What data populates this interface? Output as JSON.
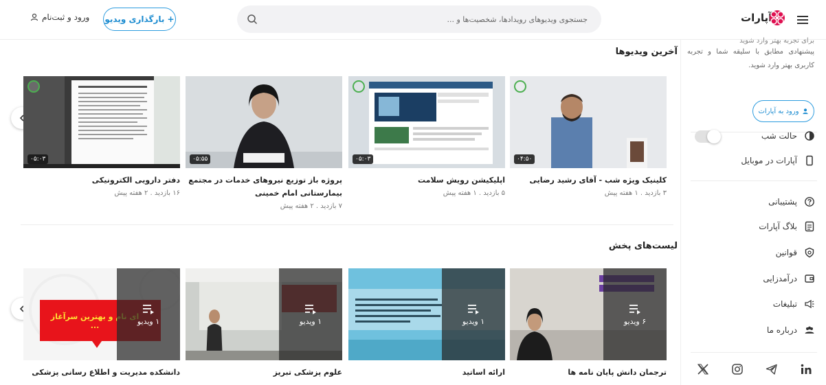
{
  "header": {
    "logo_text": "آپارات",
    "search_placeholder": "جستجوی ویدیوهای رویدادها، شخصیت‌ها و ...",
    "upload_label": "+ بارگذاری ویدیو",
    "login_label": "ورود و ثبت‌نام"
  },
  "sidebar": {
    "intro_cut": "برای تجربه بهتر وارد شوید",
    "intro_text": "پیشنهادی مطابق با سلیقه شما و تجربه کاربری بهتر وارد شوید.",
    "login_button": "ورود به آپارات",
    "dark_mode_label": "حالت شب",
    "mobile_label": "آپارات در موبایل",
    "items": [
      {
        "label": "پشتیبانی",
        "icon": "help-circle-icon"
      },
      {
        "label": "بلاگ آپارات",
        "icon": "blog-icon"
      },
      {
        "label": "قوانین",
        "icon": "shield-icon"
      },
      {
        "label": "درآمدزایی",
        "icon": "wallet-icon"
      },
      {
        "label": "تبلیغات",
        "icon": "megaphone-icon"
      },
      {
        "label": "درباره ما",
        "icon": "people-icon"
      }
    ],
    "socials": [
      "linkedin-icon",
      "telegram-icon",
      "instagram-icon",
      "x-icon"
    ]
  },
  "latest": {
    "title": "آخرین ویدیوها",
    "videos": [
      {
        "title": "کلینیک ویژه شب - آقای رشید رضایی",
        "views": "۳ بازدید",
        "ago": "۱ هفته پیش",
        "duration": "۰۴:۵۰"
      },
      {
        "title": "اپلیکیشن رویش سلامت",
        "views": "۵ بازدید",
        "ago": "۱ هفته پیش",
        "duration": "۰۵:۰۳"
      },
      {
        "title": "پروژه باز توزیع نیروهای خدمات در مجتمع بیمارستانی امام خمینی",
        "views": "۷ بازدید",
        "ago": "۲ هفته پیش",
        "duration": "۰۵:۵۵"
      },
      {
        "title": "دفتر دارویی الکترونیکی",
        "views": "۱۶ بازدید",
        "ago": "۲ هفته پیش",
        "duration": "۰۵:۰۳"
      }
    ]
  },
  "playlists": {
    "title": "لیست‌های پخش",
    "items": [
      {
        "title": "ترجمان دانش پایان نامه ها",
        "count": "۶ ویدیو"
      },
      {
        "title": "ارائه اساتید",
        "count": "۱ ویدیو"
      },
      {
        "title": "علوم پزشکی تبریز",
        "count": "۱ ویدیو"
      },
      {
        "title": "دانشکده مدیریت و اطلاع رسانی پزشکی",
        "count": "۱ ویدیو",
        "banner": "ای نام و بهترین سرآغاز ..."
      }
    ]
  },
  "meta_sep": "."
}
